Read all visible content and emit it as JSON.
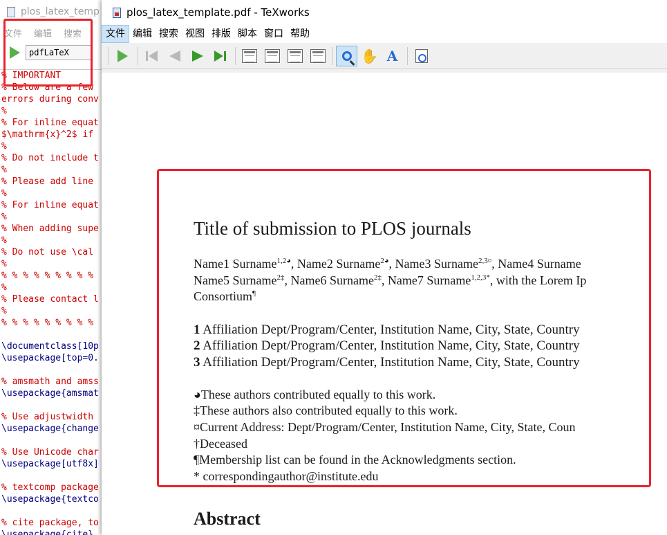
{
  "editor": {
    "title": "plos_latex_temp",
    "menu": [
      "文件",
      "编辑",
      "搜索"
    ],
    "engine": "pdfLaTeX",
    "code_lines": [
      {
        "text": "% IMPORTANT",
        "kind": "comment"
      },
      {
        "text": "% Below are a few",
        "kind": "comment"
      },
      {
        "text": "errors during conv",
        "kind": "comment"
      },
      {
        "text": "%",
        "kind": "comment"
      },
      {
        "text": "% For inline equat",
        "kind": "comment"
      },
      {
        "text": "$\\mathrm{x}^2$ if",
        "kind": "comment"
      },
      {
        "text": "%",
        "kind": "comment"
      },
      {
        "text": "% Do not include t",
        "kind": "comment"
      },
      {
        "text": "%",
        "kind": "comment"
      },
      {
        "text": "% Please add line",
        "kind": "comment"
      },
      {
        "text": "%",
        "kind": "comment"
      },
      {
        "text": "% For inline equat",
        "kind": "comment"
      },
      {
        "text": "%",
        "kind": "comment"
      },
      {
        "text": "% When adding supe",
        "kind": "comment"
      },
      {
        "text": "%",
        "kind": "comment"
      },
      {
        "text": "% Do not use \\cal",
        "kind": "comment"
      },
      {
        "text": "%",
        "kind": "comment"
      },
      {
        "text": "% % % % % % % % %",
        "kind": "comment"
      },
      {
        "text": "%",
        "kind": "comment"
      },
      {
        "text": "% Please contact l",
        "kind": "comment"
      },
      {
        "text": "%",
        "kind": "comment"
      },
      {
        "text": "% % % % % % % % %",
        "kind": "comment"
      },
      {
        "text": "",
        "kind": "blank"
      },
      {
        "text": "\\documentclass[10p",
        "kind": "code"
      },
      {
        "text": "\\usepackage[top=0.",
        "kind": "code"
      },
      {
        "text": "",
        "kind": "blank"
      },
      {
        "text": "% amsmath and amss",
        "kind": "comment"
      },
      {
        "text": "\\usepackage{amsmat",
        "kind": "code"
      },
      {
        "text": "",
        "kind": "blank"
      },
      {
        "text": "% Use adjustwidth",
        "kind": "comment"
      },
      {
        "text": "\\usepackage{change",
        "kind": "code"
      },
      {
        "text": "",
        "kind": "blank"
      },
      {
        "text": "% Use Unicode char",
        "kind": "comment"
      },
      {
        "text": "\\usepackage[utf8x]",
        "kind": "code"
      },
      {
        "text": "",
        "kind": "blank"
      },
      {
        "text": "% textcomp package",
        "kind": "comment"
      },
      {
        "text": "\\usepackage{textco",
        "kind": "code"
      },
      {
        "text": "",
        "kind": "blank"
      },
      {
        "text": "% cite package, to",
        "kind": "comment"
      },
      {
        "text": "\\usepackage{cite}",
        "kind": "code"
      }
    ]
  },
  "viewer": {
    "title": "plos_latex_template.pdf - TeXworks",
    "menu": [
      "文件",
      "编辑",
      "搜索",
      "视图",
      "排版",
      "脚本",
      "窗口",
      "帮助"
    ],
    "active_menu": "文件"
  },
  "paper": {
    "title": "Title of submission to PLOS journals",
    "authors_line1": [
      {
        "name": "Name1 Surname",
        "sup": "1,2◕"
      },
      {
        "name": ", Name2 Surname",
        "sup": "2◕"
      },
      {
        "name": ", Name3 Surname",
        "sup": "2,3¤"
      },
      {
        "name": ", Name4 Surname",
        "sup": ""
      }
    ],
    "authors_line2": [
      {
        "name": "Name5 Surname",
        "sup": "2‡"
      },
      {
        "name": ", Name6 Surname",
        "sup": "2‡"
      },
      {
        "name": ", Name7 Surname",
        "sup": "1,2,3*"
      },
      {
        "name": ", with the Lorem Ip",
        "sup": ""
      }
    ],
    "authors_line3": {
      "name": "Consortium",
      "sup": "¶"
    },
    "affiliations": [
      {
        "num": "1",
        "text": " Affiliation Dept/Program/Center, Institution Name, City, State, Country"
      },
      {
        "num": "2",
        "text": " Affiliation Dept/Program/Center, Institution Name, City, State, Country"
      },
      {
        "num": "3",
        "text": " Affiliation Dept/Program/Center, Institution Name, City, State, Country"
      }
    ],
    "notes": [
      "◕These authors contributed equally to this work.",
      "‡These authors also contributed equally to this work.",
      "¤Current Address: Dept/Program/Center, Institution Name, City, State, Coun",
      "†Deceased",
      "¶Membership list can be found in the Acknowledgments section.",
      "* correspondingauthor@institute.edu"
    ],
    "abstract_heading": "Abstract"
  },
  "colors": {
    "highlight_box": "#e8232b",
    "comment": "#cc0000",
    "code": "#000080",
    "play_green": "#56b04a"
  }
}
